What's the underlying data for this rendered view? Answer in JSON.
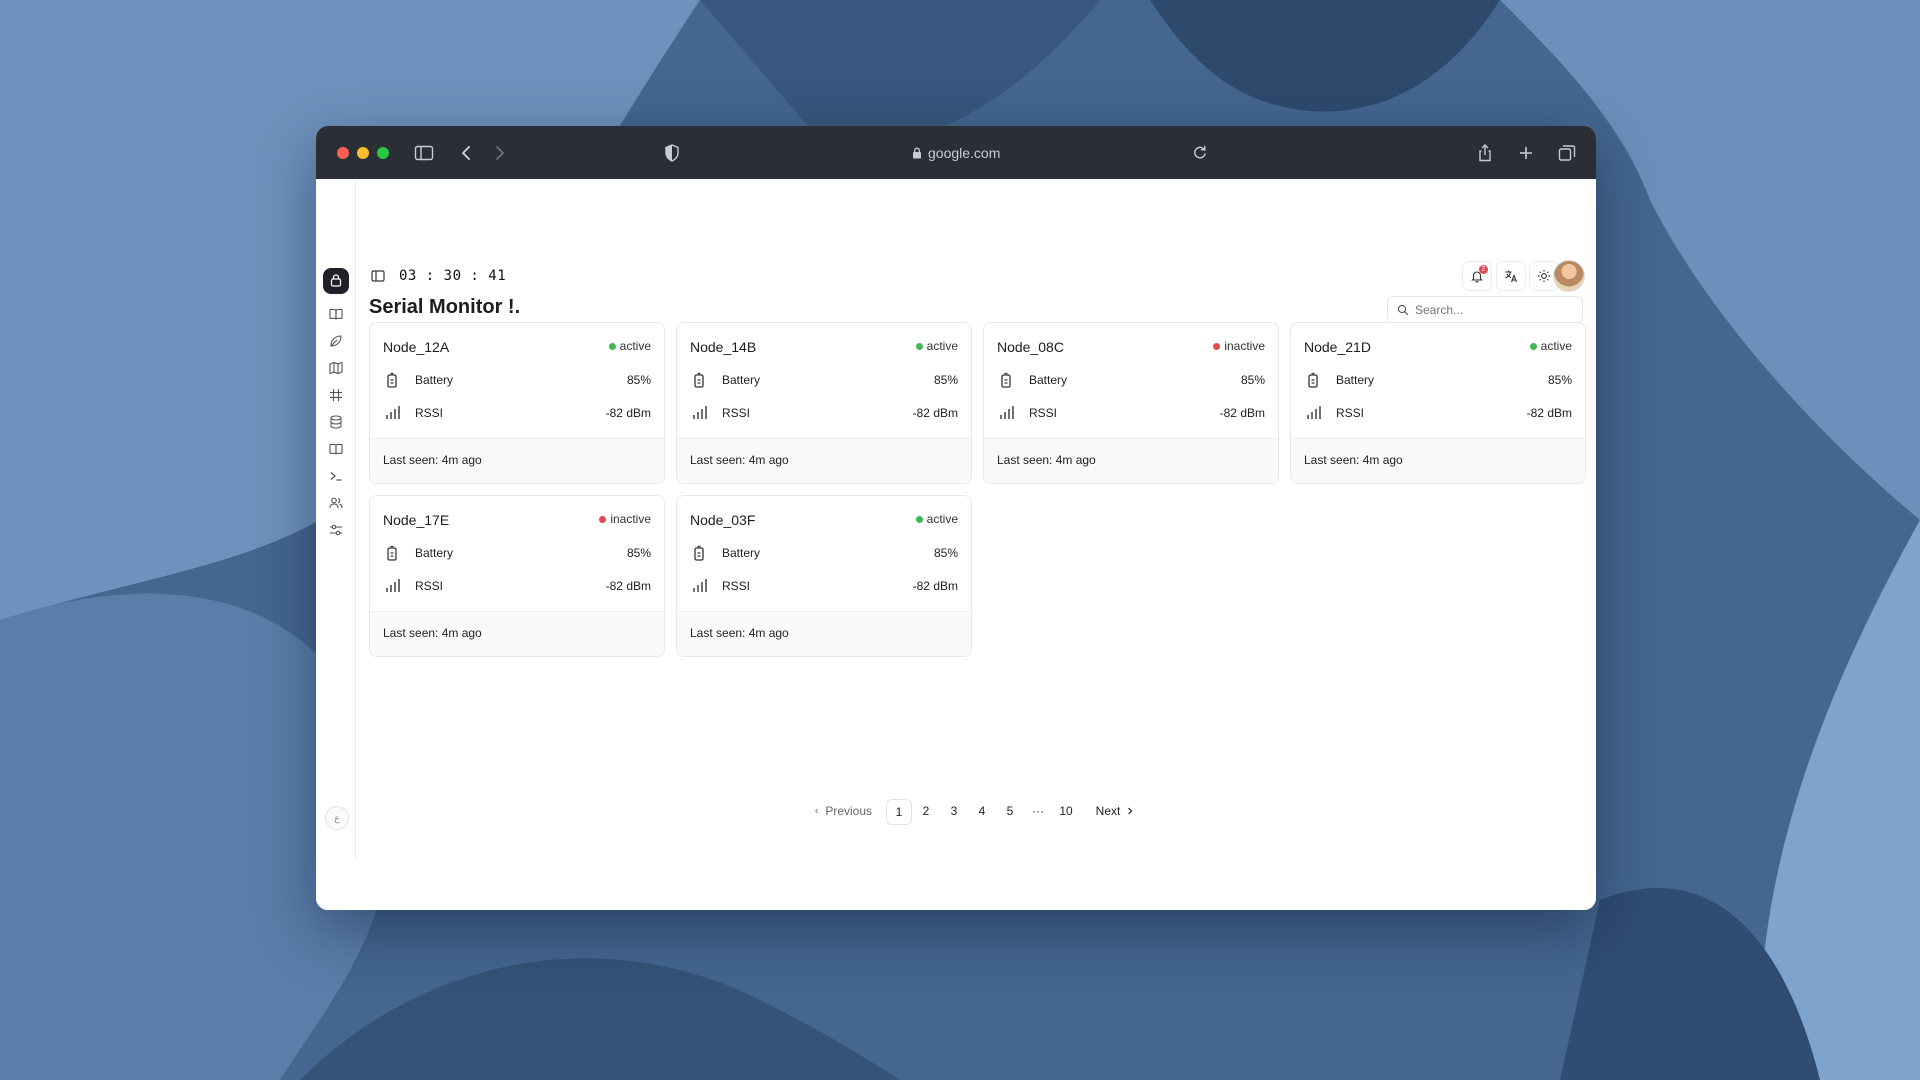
{
  "browser": {
    "url": "google.com"
  },
  "header": {
    "timer": "03 : 30 : 41",
    "notifications_count": "2"
  },
  "page": {
    "title": "Serial Monitor !."
  },
  "search": {
    "placeholder": "Search..."
  },
  "nodes": [
    {
      "name": "Node_12A",
      "status": "active",
      "battery_label": "Battery",
      "battery": "85%",
      "rssi_label": "RSSI",
      "rssi": "-82 dBm",
      "last_seen": "Last seen: 4m ago"
    },
    {
      "name": "Node_14B",
      "status": "active",
      "battery_label": "Battery",
      "battery": "85%",
      "rssi_label": "RSSI",
      "rssi": "-82 dBm",
      "last_seen": "Last seen: 4m ago"
    },
    {
      "name": "Node_08C",
      "status": "inactive",
      "battery_label": "Battery",
      "battery": "85%",
      "rssi_label": "RSSI",
      "rssi": "-82 dBm",
      "last_seen": "Last seen: 4m ago"
    },
    {
      "name": "Node_21D",
      "status": "active",
      "battery_label": "Battery",
      "battery": "85%",
      "rssi_label": "RSSI",
      "rssi": "-82 dBm",
      "last_seen": "Last seen: 4m ago"
    },
    {
      "name": "Node_17E",
      "status": "inactive",
      "battery_label": "Battery",
      "battery": "85%",
      "rssi_label": "RSSI",
      "rssi": "-82 dBm",
      "last_seen": "Last seen: 4m ago"
    },
    {
      "name": "Node_03F",
      "status": "active",
      "battery_label": "Battery",
      "battery": "85%",
      "rssi_label": "RSSI",
      "rssi": "-82 dBm",
      "last_seen": "Last seen: 4m ago"
    }
  ],
  "pagination": {
    "previous": "Previous",
    "pages": [
      "1",
      "2",
      "3",
      "4",
      "5"
    ],
    "ellipsis": "···",
    "last_page": "10",
    "next": "Next",
    "current": "1"
  },
  "colors": {
    "active": "#3fb950",
    "inactive": "#e5484d"
  },
  "sidebar": {
    "icons": [
      "book-icon",
      "leaf-icon",
      "map-icon",
      "hash-icon",
      "database-icon",
      "book-open-icon",
      "terminal-icon",
      "users-icon",
      "sliders-icon"
    ]
  }
}
